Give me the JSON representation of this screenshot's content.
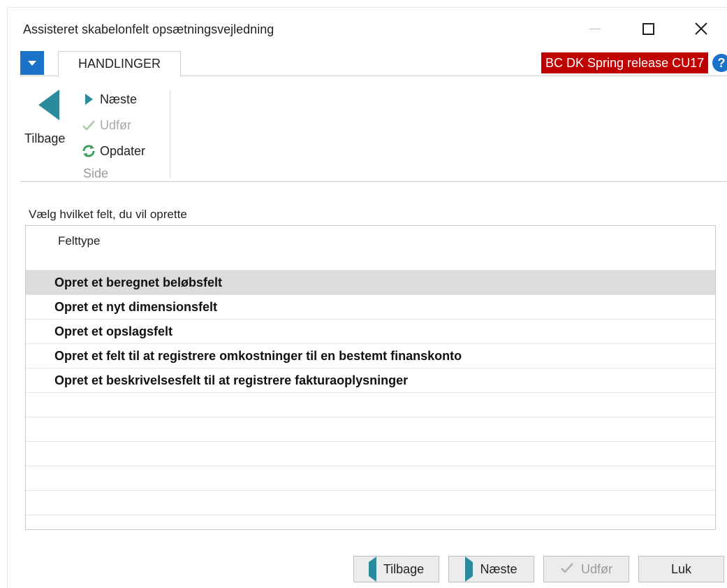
{
  "window": {
    "title": "Assisteret skabelonfelt opsætningsvejledning"
  },
  "tabs": {
    "active_label": "HANDLINGER"
  },
  "release_badge": "BC DK Spring release CU17",
  "ribbon": {
    "back_label": "Tilbage",
    "next_label": "Næste",
    "finish_label": "Udfør",
    "refresh_label": "Opdater",
    "group_label": "Side"
  },
  "main": {
    "caption": "Vælg hvilket felt, du vil oprette",
    "column_header": "Felttype",
    "rows": [
      "Opret et beregnet beløbsfelt",
      "Opret et nyt dimensionsfelt",
      "Opret et opslagsfelt",
      "Opret et felt til at registrere omkostninger til en bestemt finanskonto",
      "Opret et beskrivelsesfelt til at registrere fakturaoplysninger"
    ],
    "selected_row": 0
  },
  "footer": {
    "back_label": "Tilbage",
    "next_label": "Næste",
    "finish_label": "Udfør",
    "close_label": "Luk"
  },
  "colors": {
    "accent_blue": "#1a73c8",
    "nav_teal": "#2b8a9b",
    "badge_red": "#c00000",
    "refresh_green": "#3aa05a"
  },
  "icons": {
    "menu": "chevron-down-icon",
    "back": "arrow-left-icon",
    "next": "arrow-right-icon",
    "finish": "checkmark-icon",
    "refresh": "refresh-icon",
    "help": "help-icon"
  }
}
